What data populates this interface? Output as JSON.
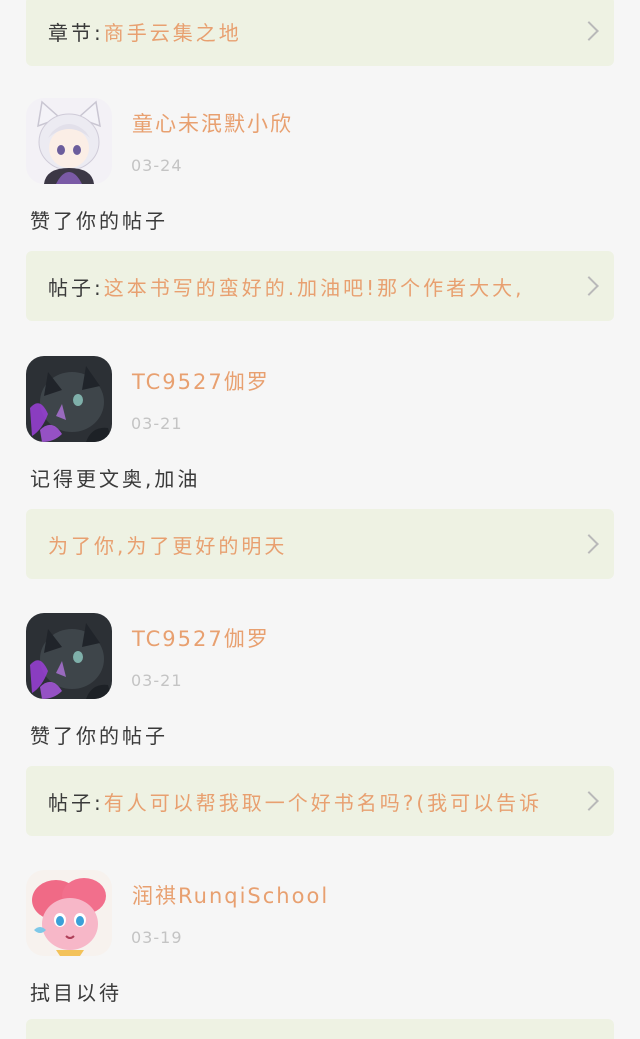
{
  "items": [
    {
      "ref": {
        "prefix": "章节:",
        "text": "商手云集之地"
      }
    },
    {
      "user": "童心未泯默小欣",
      "date": "03-24",
      "avatar": "white-haired-cat-ear-anime-avatar",
      "message": "赞了你的帖子",
      "ref": {
        "prefix": "帖子:",
        "text": "这本书写的蛮好的.加油吧!那个作者大大,"
      }
    },
    {
      "user": "TC9527伽罗",
      "date": "03-21",
      "avatar": "dark-pony-purple-glow-avatar",
      "message": "记得更文奥,加油",
      "ref": {
        "prefix": "",
        "text": "为了你,为了更好的明天"
      }
    },
    {
      "user": "TC9527伽罗",
      "date": "03-21",
      "avatar": "dark-pony-purple-glow-avatar",
      "message": "赞了你的帖子",
      "ref": {
        "prefix": "帖子:",
        "text": "有人可以帮我取一个好书名吗?(我可以告诉"
      }
    },
    {
      "user": "润祺RunqiSchool",
      "date": "03-19",
      "avatar": "pink-pony-avatar",
      "message": "拭目以待"
    }
  ],
  "icons": {
    "chevron": "chevron-right-icon"
  },
  "colors": {
    "background": "#f6f6f6",
    "card": "#eef2e3",
    "accent": "#e8a070",
    "text": "#3a3a3a",
    "muted": "#c4c4c4"
  }
}
